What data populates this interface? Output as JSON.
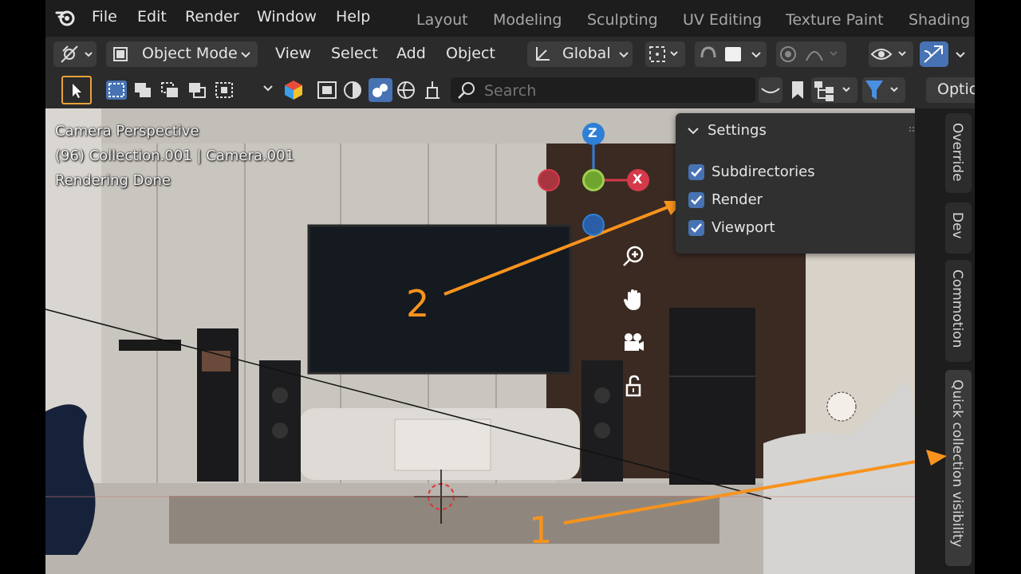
{
  "menu": {
    "items": [
      "File",
      "Edit",
      "Render",
      "Window",
      "Help"
    ],
    "workspaces": [
      "Layout",
      "Modeling",
      "Sculpting",
      "UV Editing",
      "Texture Paint",
      "Shading"
    ]
  },
  "header": {
    "mode": "Object Mode",
    "menus": [
      "View",
      "Select",
      "Add",
      "Object"
    ],
    "orientation": "Global"
  },
  "toolbar": {
    "search_placeholder": "Search",
    "options_label": "Optic"
  },
  "viewport": {
    "line1": "Camera Perspective",
    "line2": "(96) Collection.001 | Camera.001",
    "line3": "Rendering Done",
    "gizmo": {
      "z": "Z",
      "x": "X"
    }
  },
  "settings_panel": {
    "title": "Settings",
    "items": [
      {
        "label": "Subdirectories",
        "checked": true
      },
      {
        "label": "Render",
        "checked": true
      },
      {
        "label": "Viewport",
        "checked": true
      }
    ]
  },
  "side_tabs": [
    "Override",
    "Dev",
    "Commotion",
    "Quick collection visibility"
  ],
  "annotations": {
    "one": "1",
    "two": "2"
  },
  "colors": {
    "accent": "#4772b3",
    "annotation": "#f7931e",
    "x_axis": "#d63a4a",
    "z_axis": "#2e7fd6",
    "y_axis": "#6fa52f"
  }
}
